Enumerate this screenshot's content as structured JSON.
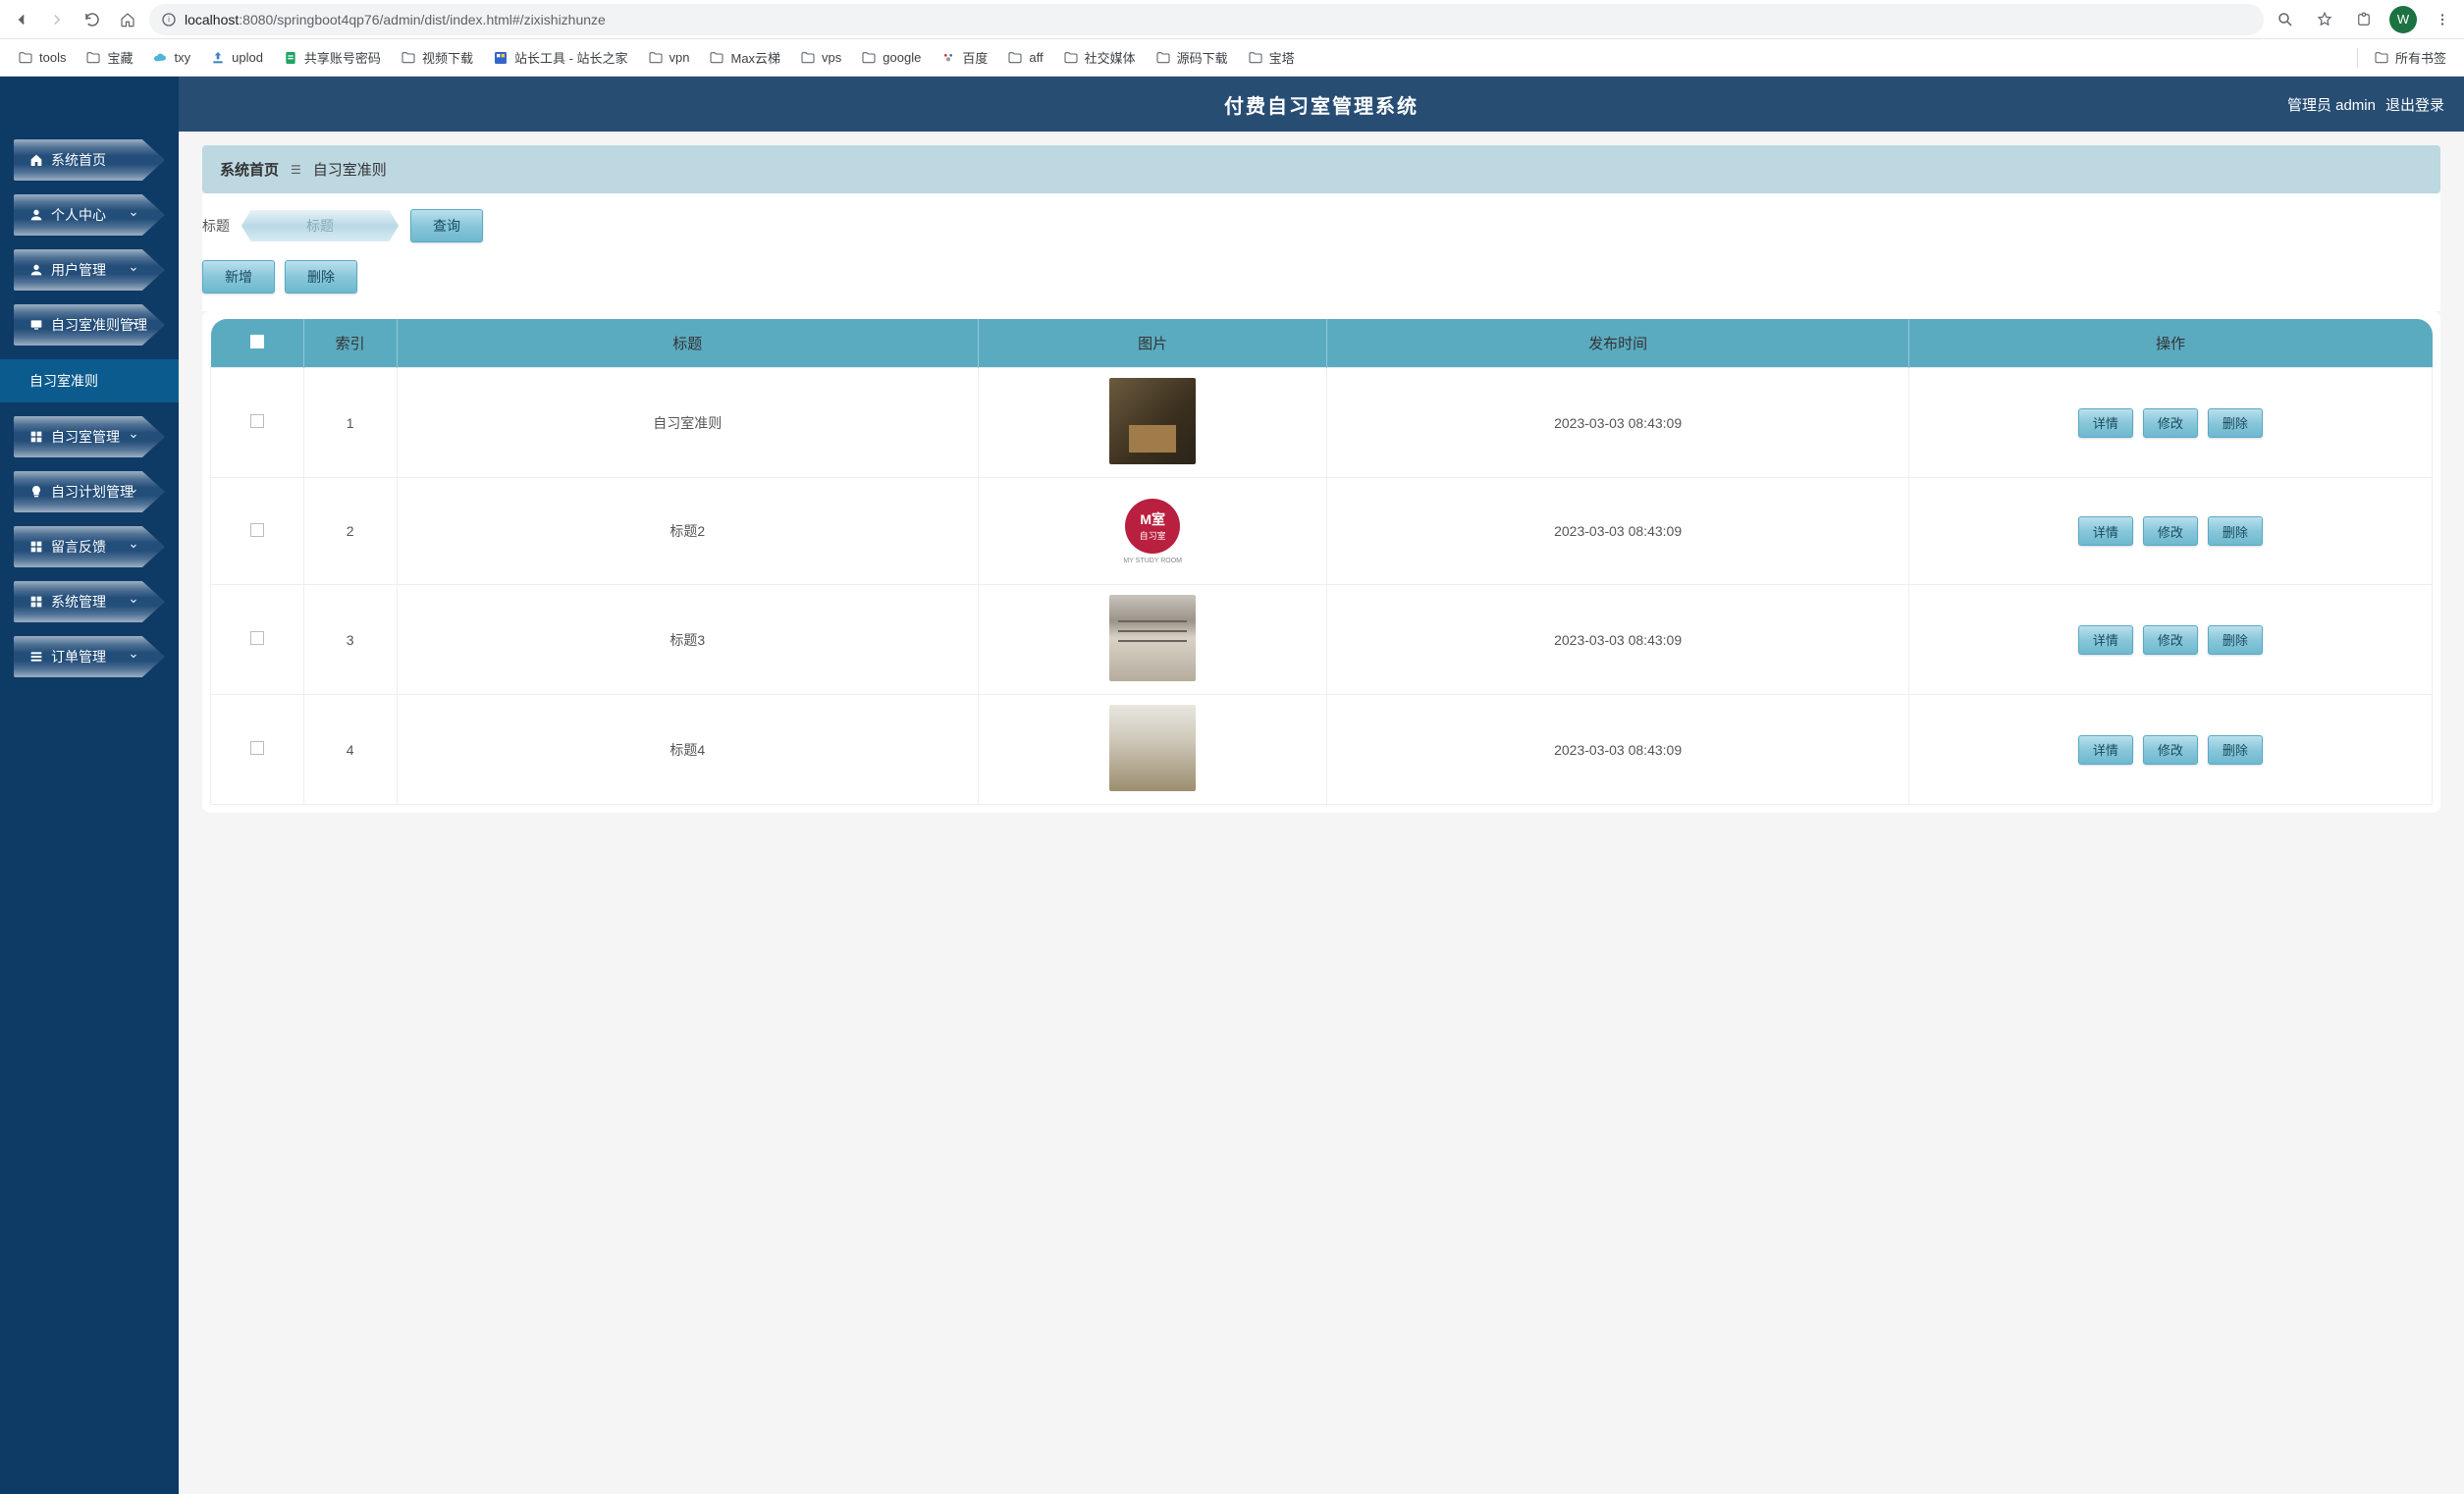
{
  "browser": {
    "url_prefix": "localhost",
    "url_rest": ":8080/springboot4qp76/admin/dist/index.html#/zixishizhunze",
    "avatar_letter": "W"
  },
  "bookmarks": [
    {
      "label": "tools",
      "icon": "folder"
    },
    {
      "label": "宝藏",
      "icon": "folder"
    },
    {
      "label": "txy",
      "icon": "cloud"
    },
    {
      "label": "uplod",
      "icon": "upload"
    },
    {
      "label": "共享账号密码",
      "icon": "sheet"
    },
    {
      "label": "视频下载",
      "icon": "folder"
    },
    {
      "label": "站长工具 - 站长之家",
      "icon": "site"
    },
    {
      "label": "vpn",
      "icon": "folder"
    },
    {
      "label": "Max云梯",
      "icon": "folder"
    },
    {
      "label": "vps",
      "icon": "folder"
    },
    {
      "label": "google",
      "icon": "folder"
    },
    {
      "label": "百度",
      "icon": "paw"
    },
    {
      "label": "aff",
      "icon": "folder"
    },
    {
      "label": "社交媒体",
      "icon": "folder"
    },
    {
      "label": "源码下载",
      "icon": "folder"
    },
    {
      "label": "宝塔",
      "icon": "folder"
    }
  ],
  "bookmarks_all": "所有书签",
  "sidebar": {
    "items": [
      {
        "label": "系统首页",
        "icon": "home",
        "expandable": false
      },
      {
        "label": "个人中心",
        "icon": "person",
        "expandable": true
      },
      {
        "label": "用户管理",
        "icon": "person",
        "expandable": true
      },
      {
        "label": "自习室准则管理",
        "icon": "device",
        "expandable": true,
        "expanded": true
      },
      {
        "label": "自习室管理",
        "icon": "grid",
        "expandable": true
      },
      {
        "label": "自习计划管理",
        "icon": "bulb",
        "expandable": true
      },
      {
        "label": "留言反馈",
        "icon": "grid",
        "expandable": true
      },
      {
        "label": "系统管理",
        "icon": "grid",
        "expandable": true
      },
      {
        "label": "订单管理",
        "icon": "list",
        "expandable": true
      }
    ],
    "sub_active": "自习室准则"
  },
  "topbar": {
    "title": "付费自习室管理系统",
    "role": "管理员",
    "user": "admin",
    "logout": "退出登录"
  },
  "breadcrumb": {
    "home": "系统首页",
    "current": "自习室准则"
  },
  "search": {
    "label": "标题",
    "placeholder": "标题",
    "query_btn": "查询"
  },
  "actions": {
    "add": "新增",
    "delete": "删除"
  },
  "table": {
    "headers": {
      "index": "索引",
      "title": "标题",
      "image": "图片",
      "time": "发布时间",
      "action": "操作"
    },
    "row_actions": {
      "detail": "详情",
      "edit": "修改",
      "delete": "删除"
    },
    "rows": [
      {
        "idx": "1",
        "title": "自习室准则",
        "time": "2023-03-03 08:43:09",
        "thumb": "room1"
      },
      {
        "idx": "2",
        "title": "标题2",
        "time": "2023-03-03 08:43:09",
        "thumb": "logo",
        "logo_text": "MY STUDY ROOM"
      },
      {
        "idx": "3",
        "title": "标题3",
        "time": "2023-03-03 08:43:09",
        "thumb": "hall"
      },
      {
        "idx": "4",
        "title": "标题4",
        "time": "2023-03-03 08:43:09",
        "thumb": "study"
      }
    ]
  }
}
